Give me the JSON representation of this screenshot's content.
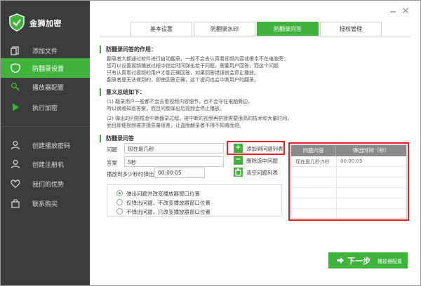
{
  "app": {
    "title": "金狮加密"
  },
  "sidebar": {
    "items": [
      {
        "label": "添加文件",
        "icon": "file-icon",
        "active": false
      },
      {
        "label": "防翻录设置",
        "icon": "shield-icon",
        "active": true
      },
      {
        "label": "播放器配置",
        "icon": "key-icon",
        "active": false
      },
      {
        "label": "执行加密",
        "icon": "play-icon",
        "active": false
      },
      {
        "label": "创建播放密码",
        "icon": "user-icon",
        "active": false
      },
      {
        "label": "创建注册机",
        "icon": "user-icon",
        "active": false
      },
      {
        "label": "我们的优势",
        "icon": "heart-icon",
        "active": false
      },
      {
        "label": "联系购买",
        "icon": "bag-icon",
        "active": false
      }
    ]
  },
  "tabs": [
    {
      "label": "基本设置",
      "active": false
    },
    {
      "label": "防翻录水印",
      "active": false
    },
    {
      "label": "防翻录问答",
      "active": true
    },
    {
      "label": "授权管理",
      "active": false
    }
  ],
  "section1": {
    "title": "防翻录问答的作用：",
    "lines": [
      "翻录者大都通过软件进行自动翻录，一般不会去认真看视频内容或根本不在电脑旁；",
      "您可以设置视频播放过程中指定时间弹出若干问题，需要用户回答，而这个问题",
      "只有认真看过视频的用户才能正确回答，如果回答错误就会停止播放。",
      "翻录者是无法做到的，即使回答正确，这个提问也会中断用户的翻录。"
    ]
  },
  "section2": {
    "title": "意义总结如下：",
    "lines": [
      "(1) 翻录用户一般都不会去看视频内容细节，也不会守在电脑旁边，",
      "所以很难知道答案，而且问题弹出后视频会停止播放。",
      "(2) 弹出的问题框会中断翻录过程，被中断的视频再拼接需要很高的技术和大量时间，",
      "而且即便视频被拼接质量很差，让盗版翻录者不得不知难而退。"
    ]
  },
  "section3": {
    "title": "防翻录问答"
  },
  "form": {
    "question_label": "问题",
    "question_value": "现在是几秒",
    "answer_label": "答案",
    "answer_value": "5秒",
    "time_label": "播放到多少秒时弹出",
    "time_value": "00:00:05"
  },
  "actions": {
    "add": "添加到问题列表",
    "delete": "删除选中问题",
    "clear": "清空问题列表"
  },
  "radio_options": [
    {
      "label": "弹出问题并改变播放器窗口位置",
      "selected": true
    },
    {
      "label": "仅弹出问题，不改变播放器窗口位置",
      "selected": false
    },
    {
      "label": "不弹出问题，只改变播放器窗口位置",
      "selected": false
    }
  ],
  "table": {
    "headers": [
      "问题内容",
      "弹出时间（秒）"
    ],
    "rows": [
      {
        "question": "现在是几秒|5秒",
        "time": "00:00:05"
      },
      {
        "question": "",
        "time": ""
      },
      {
        "question": "",
        "time": ""
      },
      {
        "question": "",
        "time": ""
      },
      {
        "question": "",
        "time": ""
      },
      {
        "question": "",
        "time": ""
      }
    ]
  },
  "next_button": {
    "main": "下一步",
    "sub": "播放器配置"
  },
  "colors": {
    "accent": "#3fb33c",
    "sidebar": "#3a3c3e",
    "highlight": "#e02424"
  }
}
